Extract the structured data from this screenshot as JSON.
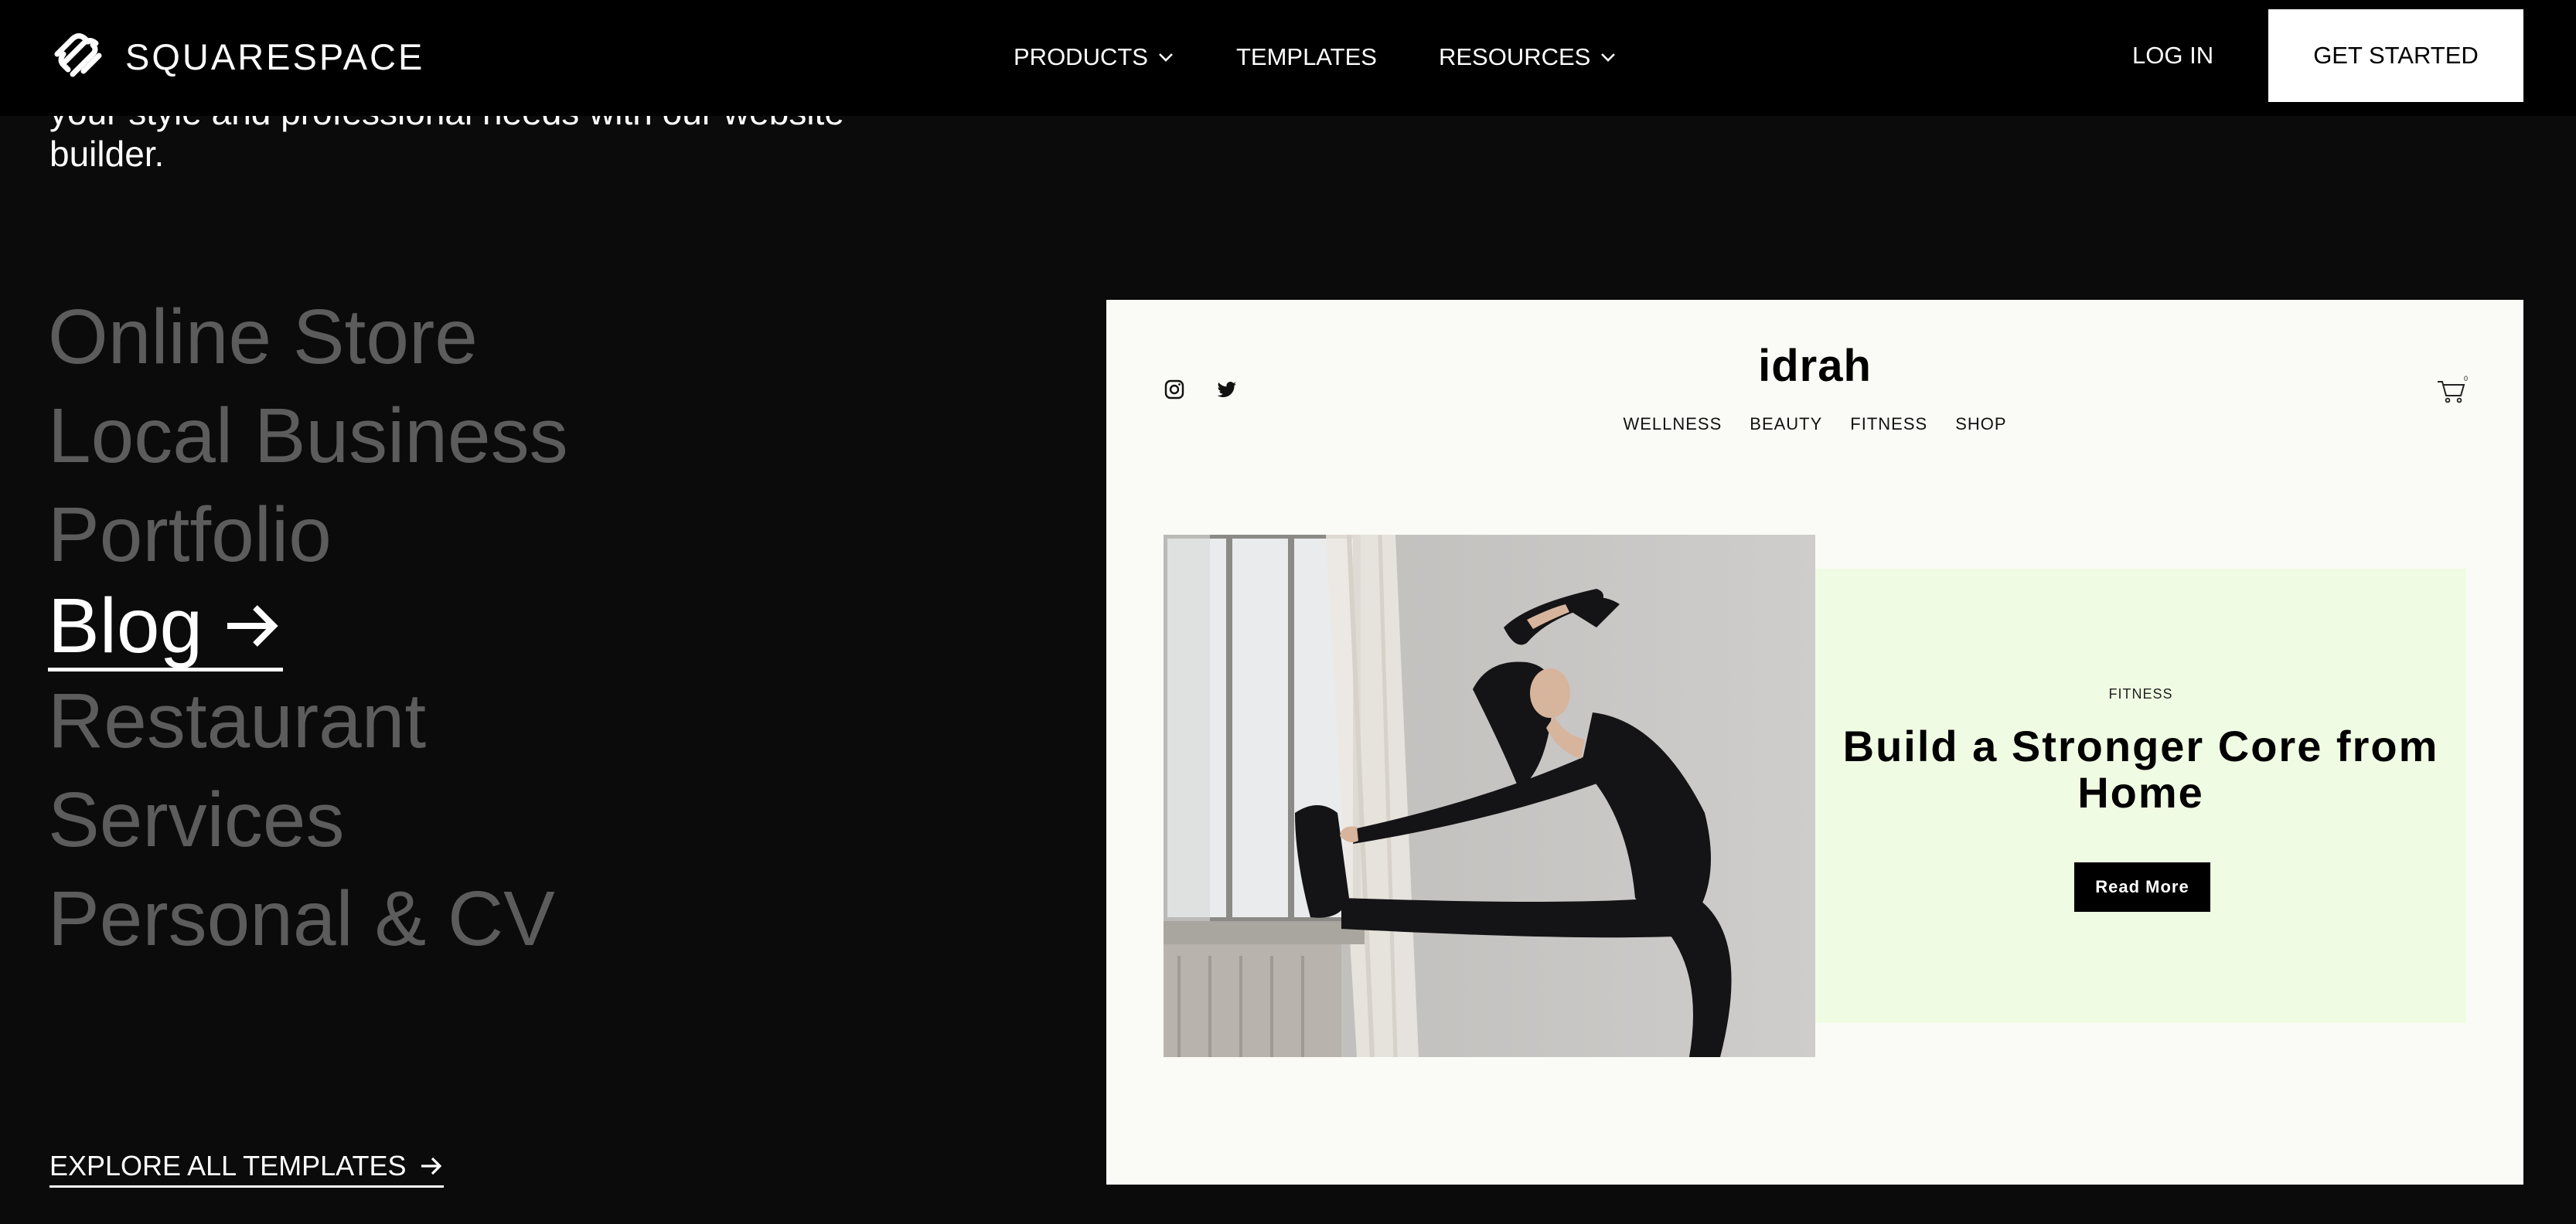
{
  "header": {
    "brand": "SQUARESPACE",
    "nav": [
      {
        "label": "PRODUCTS",
        "has_dropdown": true
      },
      {
        "label": "TEMPLATES",
        "has_dropdown": false
      },
      {
        "label": "RESOURCES",
        "has_dropdown": true
      }
    ],
    "login_label": "LOG IN",
    "cta_label": "GET STARTED"
  },
  "intro": {
    "text": "your style and professional needs with our website builder."
  },
  "categories": {
    "items": [
      {
        "label": "Online Store",
        "active": false
      },
      {
        "label": "Local Business",
        "active": false
      },
      {
        "label": "Portfolio",
        "active": false
      },
      {
        "label": "Blog",
        "active": true
      },
      {
        "label": "Restaurant",
        "active": false
      },
      {
        "label": "Services",
        "active": false
      },
      {
        "label": "Personal & CV",
        "active": false
      }
    ]
  },
  "explore_label": "EXPLORE ALL TEMPLATES",
  "preview": {
    "brand": "idrah",
    "nav": [
      "WELLNESS",
      "BEAUTY",
      "FITNESS",
      "SHOP"
    ],
    "cart_count": "0",
    "social_icons": [
      "instagram-icon",
      "twitter-icon"
    ],
    "card": {
      "kicker": "FITNESS",
      "title": "Build a Stronger Core from Home",
      "button": "Read More"
    },
    "colors": {
      "background": "#fafbf6",
      "card": "#f0fbe3"
    }
  },
  "colors": {
    "page_bg": "#0b0b0b",
    "inactive_text": "#5c5c5c"
  }
}
